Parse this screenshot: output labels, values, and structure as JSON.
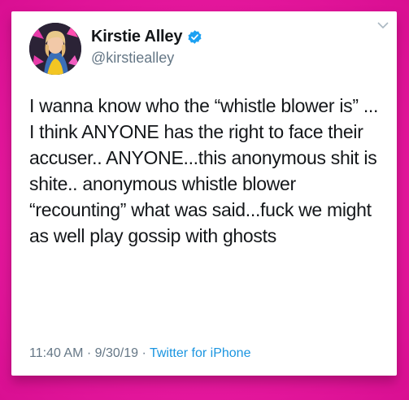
{
  "tweet": {
    "author": {
      "name": "Kirstie Alley",
      "handle": "@kirstiealley",
      "verified": true
    },
    "text": "I wanna know who the “whistle blower is” ... I think ANYONE has the right to face their accuser.. ANYONE...this anonymous shit is shite.. anonymous whistle blower “recounting” what was said...fuck we might as well play gossip with ghosts",
    "time": "11:40 AM",
    "date": "9/30/19",
    "separator": " · ",
    "source": "Twitter for iPhone"
  },
  "colors": {
    "background": "#e6199e",
    "card": "#ffffff",
    "text": "#14171a",
    "muted": "#657786",
    "link": "#1b95e0",
    "verified": "#1da1f2"
  },
  "icons": {
    "verified": "verified-badge-icon",
    "menu": "chevron-down-icon"
  }
}
